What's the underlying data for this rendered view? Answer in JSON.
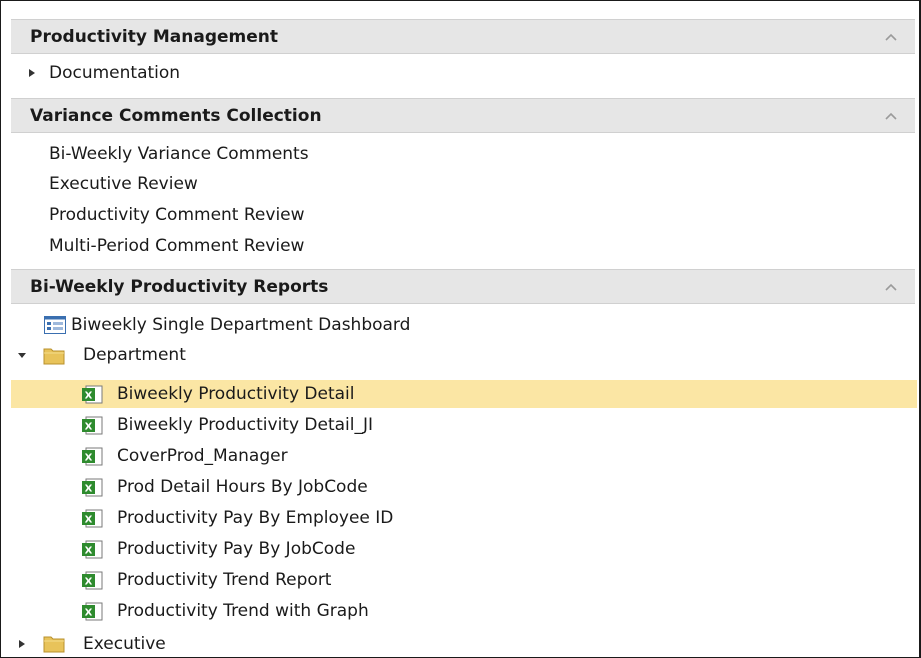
{
  "sections": [
    {
      "title": "Productivity Management",
      "collapse_icon": "chevron-up-icon",
      "items": [
        {
          "label": "Documentation",
          "expander": "collapsed"
        }
      ]
    },
    {
      "title": "Variance Comments Collection",
      "collapse_icon": "chevron-up-icon",
      "items": [
        {
          "label": "Bi-Weekly Variance Comments"
        },
        {
          "label": "Executive Review"
        },
        {
          "label": "Productivity Comment Review"
        },
        {
          "label": "Multi-Period Comment Review"
        }
      ]
    },
    {
      "title": "Bi-Weekly Productivity Reports",
      "collapse_icon": "chevron-up-icon",
      "tree": {
        "dashboard": {
          "label": "Biweekly Single Department Dashboard",
          "icon": "dashboard-icon"
        },
        "folders": [
          {
            "label": "Department",
            "icon": "folder-icon",
            "expander": "expanded",
            "children": [
              {
                "label": "Biweekly Productivity Detail",
                "icon": "excel-report-icon",
                "selected": true
              },
              {
                "label": "Biweekly Productivity Detail_JI",
                "icon": "excel-report-icon"
              },
              {
                "label": "CoverProd_Manager",
                "icon": "excel-report-icon"
              },
              {
                "label": "Prod Detail Hours By JobCode",
                "icon": "excel-report-icon"
              },
              {
                "label": "Productivity Pay By Employee ID",
                "icon": "excel-report-icon"
              },
              {
                "label": "Productivity Pay By JobCode",
                "icon": "excel-report-icon"
              },
              {
                "label": "Productivity Trend Report",
                "icon": "excel-report-icon"
              },
              {
                "label": "Productivity Trend with Graph",
                "icon": "excel-report-icon"
              }
            ]
          },
          {
            "label": "Executive",
            "icon": "folder-icon",
            "expander": "collapsed"
          }
        ]
      }
    }
  ],
  "colors": {
    "header_bg": "#e6e6e6",
    "selected_bg": "#fbe6a4",
    "excel_green": "#2e8b2e",
    "folder_yellow": "#e8c35a"
  }
}
